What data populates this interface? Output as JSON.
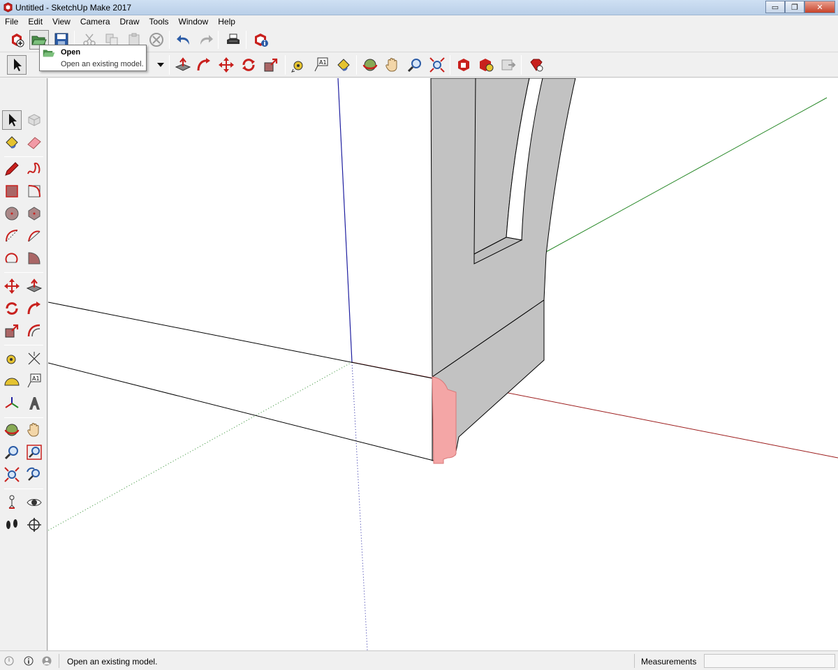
{
  "window": {
    "title": "Untitled - SketchUp Make 2017",
    "minimize_label": "▭",
    "restore_label": "❐",
    "close_label": "✕"
  },
  "menu": [
    "File",
    "Edit",
    "View",
    "Camera",
    "Draw",
    "Tools",
    "Window",
    "Help"
  ],
  "tooltip": {
    "title": "Open",
    "description": "Open an existing model."
  },
  "toolbar_icons": [
    "new-icon",
    "open-icon",
    "save-icon",
    "cut-icon",
    "copy-icon",
    "paste-icon",
    "erase-selection-icon",
    "undo-icon",
    "redo-icon",
    "print-icon",
    "model-info-icon"
  ],
  "colors": {
    "red_axis": "#9c1c1c",
    "green_axis": "#2a8a2a",
    "blue_axis": "#1f1fa0",
    "face_gray": "#c2c2c2",
    "selected_face": "#f4a6a6",
    "brand_red": "#c8201d"
  },
  "statusbar": {
    "message": "Open an existing model.",
    "measurements_label": "Measurements",
    "measurements_value": ""
  }
}
